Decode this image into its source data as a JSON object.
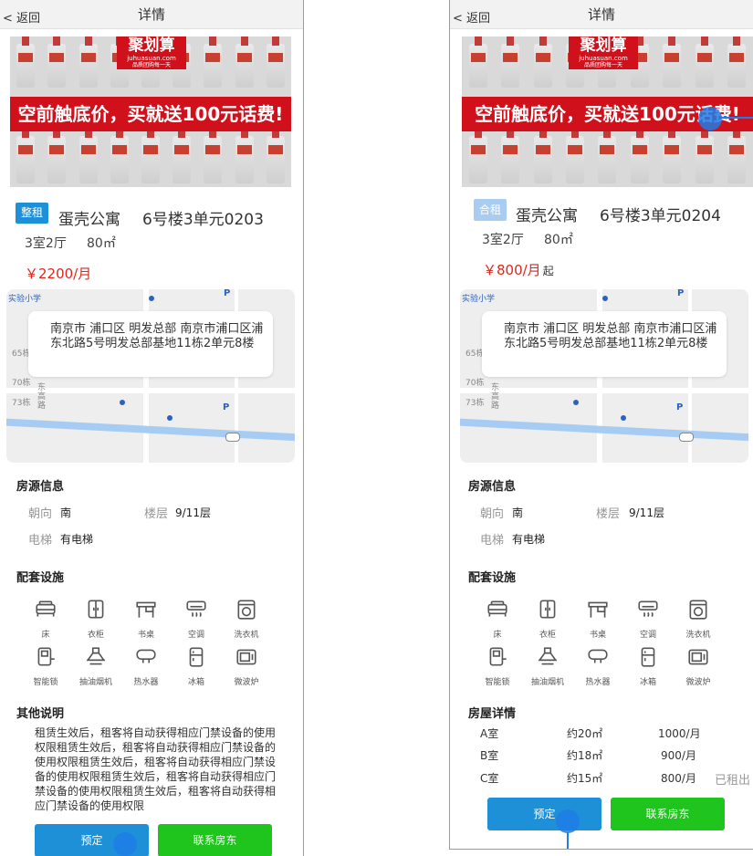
{
  "common": {
    "back_label": "< 返回",
    "nav_title": "详情",
    "banner": {
      "logo_main": "聚划算",
      "logo_sub": "juhuasuan.com",
      "logo_slogan": "品质团购每一天",
      "promo_text": "空前触底价，买就送100元话费!"
    },
    "info_section_title": "房源信息",
    "facilities_title": "配套设施",
    "info": {
      "orientation_label": "朝向",
      "orientation_value": "南",
      "floor_label": "楼层",
      "floor_value": "9/11层",
      "elevator_label": "电梯",
      "elevator_value": "有电梯"
    },
    "map": {
      "address": "南京市 浦口区 明发总部 南京市浦口区浦东北路5号明发总部基地11栋2单元8楼",
      "labels": [
        "实验小学",
        "65栋",
        "70栋",
        "73栋",
        "东",
        "高",
        "路"
      ]
    },
    "facilities": [
      {
        "label": "床",
        "icon": "bed-icon"
      },
      {
        "label": "衣柜",
        "icon": "wardrobe-icon"
      },
      {
        "label": "书桌",
        "icon": "desk-icon"
      },
      {
        "label": "空调",
        "icon": "air-conditioner-icon"
      },
      {
        "label": "洗衣机",
        "icon": "washing-machine-icon"
      },
      {
        "label": "智能锁",
        "icon": "smart-lock-icon"
      },
      {
        "label": "抽油烟机",
        "icon": "range-hood-icon"
      },
      {
        "label": "热水器",
        "icon": "water-heater-icon"
      },
      {
        "label": "冰箱",
        "icon": "fridge-icon"
      },
      {
        "label": "微波炉",
        "icon": "microwave-icon"
      }
    ],
    "book_label": "预定",
    "contact_label": "联系房东"
  },
  "left": {
    "type_tag": "整租",
    "name": "蛋壳公寓",
    "unit": "6号楼3单元0203",
    "layout": "3室2厅",
    "area": "80㎡",
    "price": "￥2200/月",
    "other_title": "其他说明",
    "other_text": "租赁生效后，租客将自动获得相应门禁设备的使用权限租赁生效后，租客将自动获得相应门禁设备的使用权限租赁生效后，租客将自动获得相应门禁设备的使用权限租赁生效后，租客将自动获得相应门禁设备的使用权限租赁生效后，租客将自动获得相应门禁设备的使用权限"
  },
  "right": {
    "type_tag": "合租",
    "name": "蛋壳公寓",
    "unit": "6号楼3单元0204",
    "layout": "3室2厅",
    "area": "80㎡",
    "price": "￥800/月",
    "price_suffix": "起",
    "rooms_title": "房屋详情",
    "rooms": [
      {
        "name": "A室",
        "area": "约20㎡",
        "price": "1000/月",
        "status": ""
      },
      {
        "name": "B室",
        "area": "约18㎡",
        "price": "900/月",
        "status": ""
      },
      {
        "name": "C室",
        "area": "约15㎡",
        "price": "800/月",
        "status": "已租出"
      }
    ]
  }
}
